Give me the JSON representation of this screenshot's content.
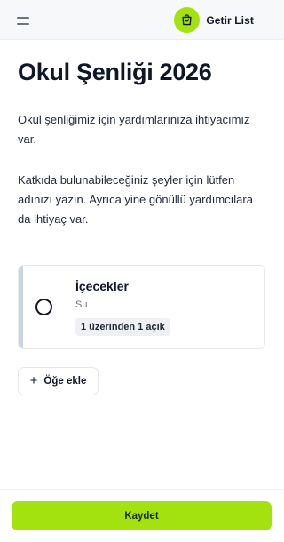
{
  "header": {
    "brand_name": "Getir List",
    "logo_icon": "shopping-bag-icon",
    "menu_icon": "menu-icon"
  },
  "page": {
    "title": "Okul Şenliği 2026",
    "paragraphs": [
      "Okul şenliğimiz için yardımlarınıza ihtiyacımız var.",
      "Katkıda bulunabileceğiniz şeyler için lütfen adınızı yazın. Ayrıca yine gönüllü yardımcılara da ihtiyaç var."
    ]
  },
  "items": [
    {
      "title": "İçecekler",
      "subtitle": "Su",
      "status": "1 üzerinden 1 açık",
      "checked": false
    }
  ],
  "actions": {
    "add_item_label": "Öğe ekle",
    "save_label": "Kaydet"
  },
  "colors": {
    "accent": "#a3e20e",
    "card_border_left": "#cbd5e1",
    "header_bg": "#f7f8fa"
  }
}
